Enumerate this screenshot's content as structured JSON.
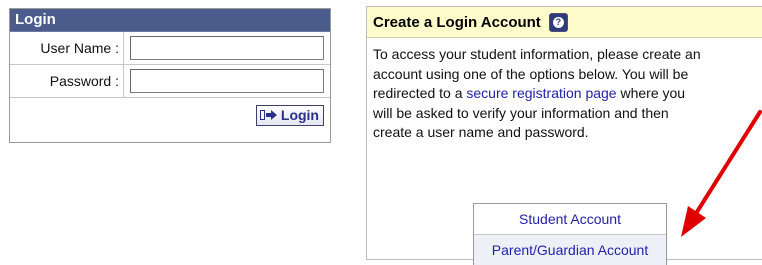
{
  "login": {
    "header": "Login",
    "username_label": "User Name :",
    "password_label": "Password :",
    "username_value": "",
    "password_value": "",
    "login_button": "Login",
    "login_icon": "arrow-into-door-icon"
  },
  "create": {
    "title": "Create a Login Account",
    "help_icon": "help-icon",
    "body_line1": "To access your student information, please create an",
    "body_line2": "account using one of the options below. You will be",
    "body_line3_pre": "redirected to a ",
    "body_link": "secure registration page",
    "body_line3_post": " where you",
    "body_line4": "will be asked to verify your information and then",
    "body_line5": "create a user name and password.",
    "options": [
      "Student Account",
      "Parent/Guardian Account"
    ]
  },
  "colors": {
    "login_header_bg": "#4a5b8c",
    "create_header_bg": "#fffccc",
    "link": "#2222aa",
    "annotation_arrow": "#e00000"
  }
}
